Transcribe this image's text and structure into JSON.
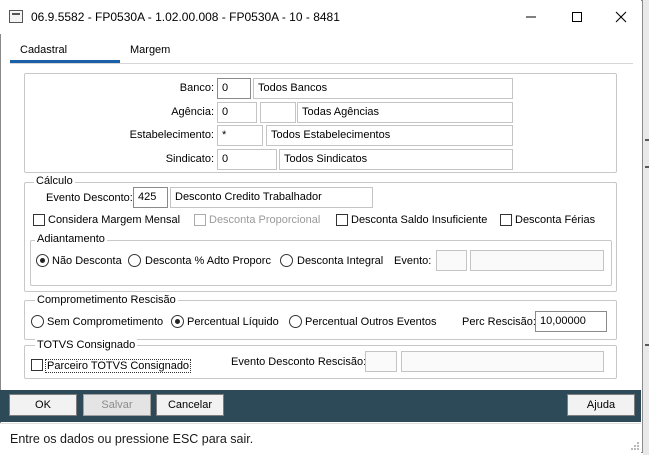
{
  "window": {
    "title": "06.9.5582 - FP0530A - 1.02.00.008 - FP0530A - 10 - 8481",
    "icons": [
      "app-icon",
      "minimize-icon",
      "maximize-icon",
      "close-icon"
    ]
  },
  "tabs": [
    {
      "label": "Cadastral",
      "active": true
    },
    {
      "label": "Margem",
      "active": false
    }
  ],
  "filters": {
    "banco": {
      "label": "Banco:",
      "code": "0",
      "description": "Todos Bancos"
    },
    "agencia": {
      "label": "Agência:",
      "code": "0",
      "code2": "",
      "description": "Todas Agências"
    },
    "estabelecimento": {
      "label": "Estabelecimento:",
      "code": "*",
      "description": "Todos Estabelecimentos"
    },
    "sindicato": {
      "label": "Sindicato:",
      "code": "0",
      "description": "Todos Sindicatos"
    }
  },
  "calculo": {
    "title": "Cálculo",
    "evento": {
      "label": "Evento Desconto:",
      "code": "425",
      "description": "Desconto Credito Trabalhador"
    },
    "checkboxes": [
      {
        "label": "Considera Margem Mensal",
        "checked": false,
        "enabled": true
      },
      {
        "label": "Desconta Proporcional",
        "checked": false,
        "enabled": false
      },
      {
        "label": "Desconta Saldo Insuficiente",
        "checked": false,
        "enabled": true
      },
      {
        "label": "Desconta Férias",
        "checked": false,
        "enabled": true
      }
    ],
    "adiantamento": {
      "title": "Adiantamento",
      "options": [
        {
          "label": "Não Desconta",
          "selected": true
        },
        {
          "label": "Desconta % Adto Proporc",
          "selected": false
        },
        {
          "label": "Desconta Integral",
          "selected": false
        }
      ],
      "evento_label": "Evento:",
      "evento_code": "",
      "evento_description": ""
    }
  },
  "rescisao": {
    "title": "Comprometimento Rescisão",
    "options": [
      {
        "label": "Sem Comprometimento",
        "selected": false
      },
      {
        "label": "Percentual Líquido",
        "selected": true
      },
      {
        "label": "Percentual Outros Eventos",
        "selected": false
      }
    ],
    "perc_label": "Perc Rescisão:",
    "perc_value": "10,00000"
  },
  "totvs": {
    "title": "TOTVS Consignado",
    "checkbox_label": "Parceiro TOTVS Consignado",
    "checked": false,
    "evento_label": "Evento Desconto Rescisão:",
    "evento_code": "",
    "evento_description": ""
  },
  "buttons": {
    "ok": "OK",
    "salvar": "Salvar",
    "cancelar": "Cancelar",
    "ajuda": "Ajuda"
  },
  "status": "Entre os dados ou pressione ESC para sair.",
  "colors": {
    "button_bar": "#2c4a58",
    "tab_accent": "#1a5fa8",
    "group_border": "#c8c8c8"
  }
}
